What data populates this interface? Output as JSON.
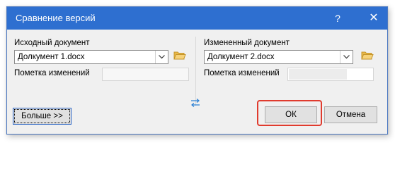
{
  "window": {
    "title": "Сравнение версий",
    "help_label": "?",
    "close_label": "✕"
  },
  "original": {
    "label": "Исходный документ",
    "value": "Долкумент 1.docx",
    "mark_label": "Пометка изменений",
    "mark_value": ""
  },
  "revised": {
    "label": "Измененный документ",
    "value": "Долкумент 2.docx",
    "mark_label": "Пометка изменений",
    "mark_value": ""
  },
  "buttons": {
    "more": "Больше >>",
    "ok": "ОК",
    "cancel": "Отмена"
  },
  "colors": {
    "titlebar": "#2e6fd0",
    "highlight": "#e03b2e",
    "folder": "#e8b84a"
  },
  "icons": {
    "browse": "folder-icon",
    "dropdown": "chevron-down-icon",
    "swap": "swap-arrows-icon"
  }
}
